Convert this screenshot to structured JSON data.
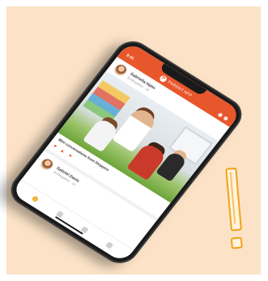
{
  "app": {
    "status_time": "9:41",
    "name": "PARENT APP",
    "logo_letter": "P"
  },
  "post": {
    "author": "Gabriella Hahn",
    "meta": "Kindergarten · 2h",
    "caption": "Mini conversations from Sloppers"
  },
  "post2": {
    "author": "Gabriel Davis",
    "meta": "Kindergarten · 5h"
  },
  "icons": {
    "like": "heart-icon",
    "comment": "comment-icon",
    "share": "share-icon"
  },
  "colors": {
    "background": "#fce3c7",
    "accent": "#e8572c",
    "exclamation": "#f0a21a"
  }
}
